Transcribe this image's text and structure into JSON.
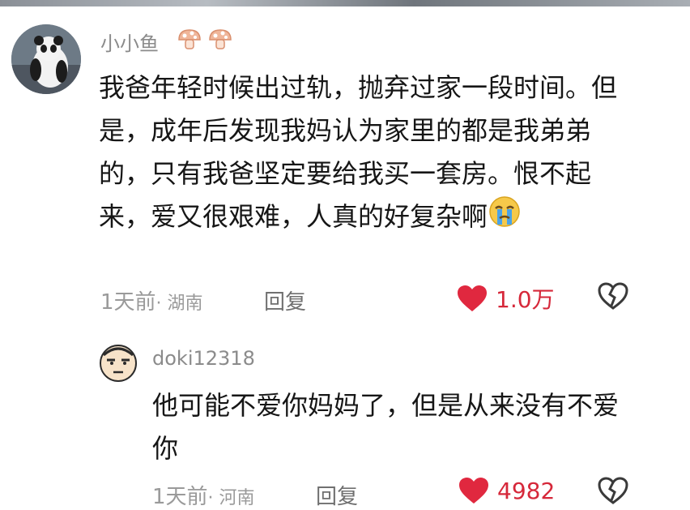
{
  "comment": {
    "username": "小小鱼",
    "text": "我爸年轻时候出过轨，抛弃过家一段时间。但是，成年后发现我妈认为家里的都是我弟弟的，只有我爸坚定要给我买一套房。恨不起来，爱又很艰难，人真的好复杂啊",
    "time": "1天前",
    "location": "· 湖南",
    "reply_label": "回复",
    "likes": "1.0万"
  },
  "reply": {
    "username": "doki12318",
    "text": "他可能不爱你妈妈了，但是从来没有不爱你",
    "time": "1天前",
    "location": "· 河南",
    "reply_label": "回复",
    "likes": "4982"
  },
  "colors": {
    "like_red": "#e0283f",
    "meta_gray": "#9a9a9a",
    "badge_orange": "#e8a889"
  }
}
